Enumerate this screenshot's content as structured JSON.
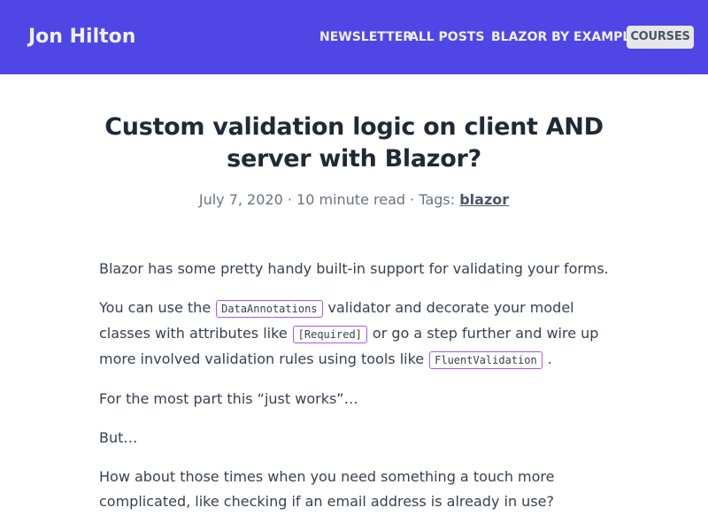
{
  "header": {
    "site_title": "Jon Hilton",
    "nav": {
      "newsletter": "NEWSLETTER",
      "all_posts": "ALL POSTS",
      "blazor_by_example": "BLAZOR BY EXAMPLE",
      "courses": "COURSES"
    }
  },
  "post": {
    "title": "Custom validation logic on client AND server with Blazor?",
    "meta": {
      "date": "July 7, 2020",
      "separator1": " · ",
      "read_time": "10 minute read",
      "separator2": " · ",
      "tags_label": "Tags: ",
      "tag": "blazor"
    },
    "paragraphs": {
      "p1": "Blazor has some pretty handy built-in support for validating your forms.",
      "p2_a": "You can use the",
      "p2_code1": "DataAnnotations",
      "p2_b": "validator and decorate your model classes with attributes like",
      "p2_code2": "[Required]",
      "p2_c": "or go a step further and wire up more involved validation rules using tools like",
      "p2_code3": "FluentValidation",
      "p2_d": ".",
      "p3": "For the most part this “just works”…",
      "p4": "But…",
      "p5": "How about those times when you need something a touch more complicated, like checking if an email address is already in use?"
    }
  },
  "colors": {
    "header_bg": "#4f46e5",
    "code_border": "#a855f7",
    "button_bg": "#e5e7eb"
  }
}
